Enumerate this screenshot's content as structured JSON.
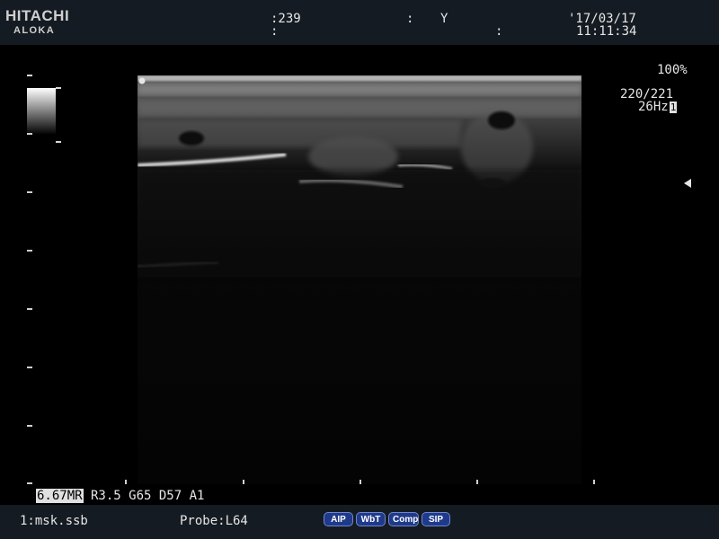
{
  "header": {
    "brand": "HITACHI",
    "brand_sub": "ALOKA",
    "field1": ":239",
    "field2": ":",
    "field3": ":",
    "field4": "Y",
    "field5": ":",
    "date": "'17/03/17",
    "time": "11:11:34"
  },
  "display": {
    "zoom": "100%",
    "frame": "220/221",
    "frame_rate": "26Hz",
    "frame_rate_box": "1"
  },
  "params": {
    "frequency": "6.67MR",
    "rest": " R3.5 G65 D57 A1"
  },
  "footer": {
    "preset": "1:msk.ssb",
    "probe": "Probe:L64"
  },
  "buttons": [
    {
      "label": "AIP"
    },
    {
      "label": "WbT"
    },
    {
      "label": "Comp"
    },
    {
      "label": "SIP"
    }
  ],
  "icons": {
    "focus_marker": "triangle-left",
    "grayscale_bar": "gradient"
  }
}
